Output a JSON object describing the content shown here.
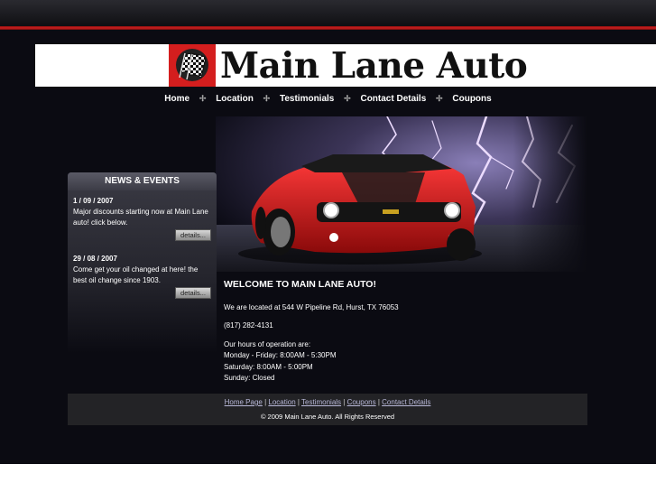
{
  "brand": {
    "name": "Main Lane Auto",
    "logo_icon": "checkered-flag-icon"
  },
  "nav": {
    "items": [
      "Home",
      "Location",
      "Testimonials",
      "Contact Details",
      "Coupons"
    ]
  },
  "news": {
    "title": "NEWS & EVENTS",
    "items": [
      {
        "date": "1 / 09 / 2007",
        "text": "Major discounts starting now at Main Lane auto! click below.",
        "button": "details..."
      },
      {
        "date": "29 / 08 / 2007",
        "text": "Come get your oil changed at here! the best oil change since 1903.",
        "button": "details..."
      }
    ]
  },
  "welcome": {
    "title": "WELCOME TO MAIN LANE AUTO!",
    "address": "We are located at 544 W Pipeline Rd, Hurst, TX 76053",
    "phone": "(817) 282-4131",
    "hours_title": "Our hours of operation are:",
    "hours": [
      "Monday - Friday: 8:00AM - 5:30PM",
      "Saturday: 8:00AM - 5:00PM",
      "Sunday: Closed"
    ]
  },
  "footer": {
    "links": [
      "Home Page",
      "Location",
      "Testimonials",
      "Coupons",
      "Contact Details"
    ],
    "separator": " | ",
    "copyright": "© 2009 Main Lane Auto. All Rights Reserved"
  },
  "colors": {
    "accent_red": "#d41e1e",
    "background": "#0b0b12",
    "car_red": "#d01818"
  }
}
